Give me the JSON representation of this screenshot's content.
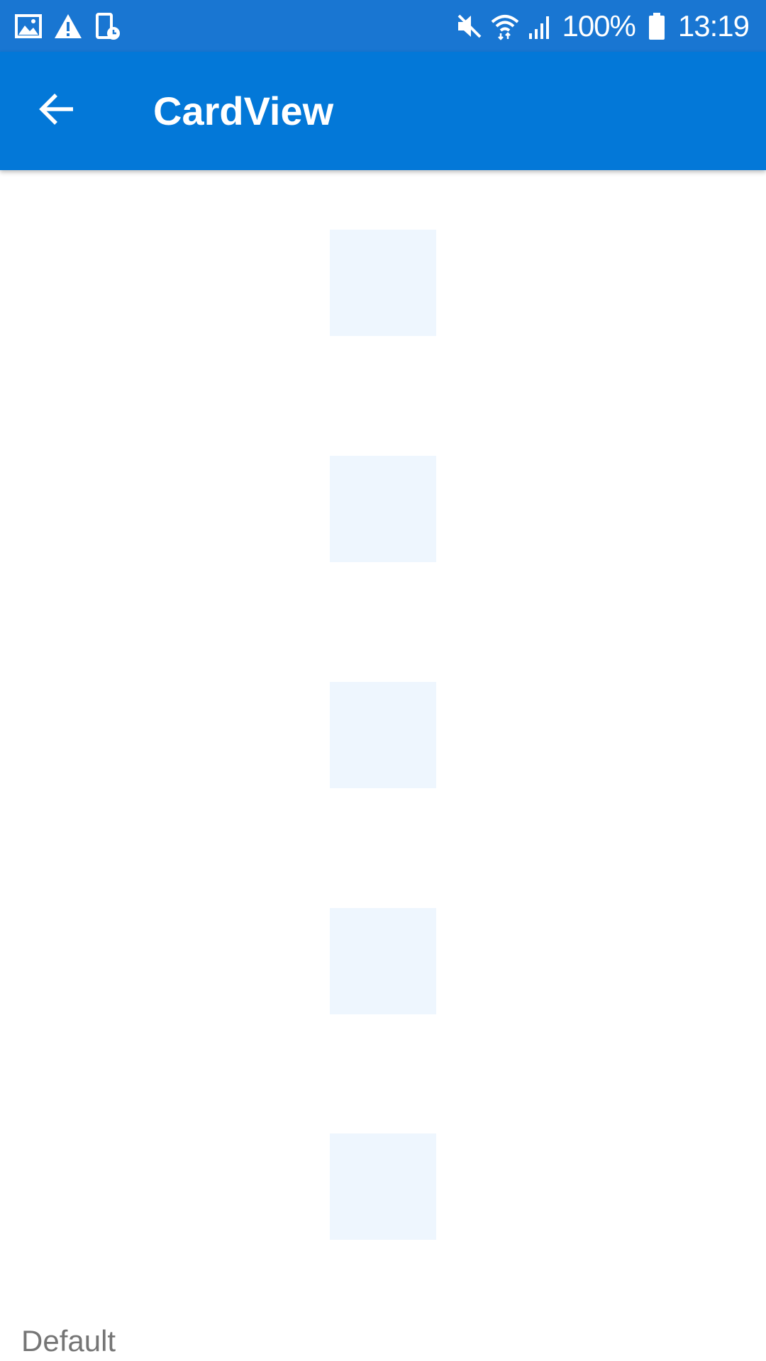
{
  "status_bar": {
    "battery_percent": "100%",
    "time": "13:19",
    "icons_left": [
      "image-icon",
      "warning-icon",
      "screen-timer-icon"
    ],
    "icons_right": [
      "mute-icon",
      "wifi-icon",
      "signal-icon",
      "battery-icon"
    ]
  },
  "app_bar": {
    "title": "CardView",
    "back_icon": "arrow-back-icon"
  },
  "content": {
    "cards": [
      {
        "id": "card-1"
      },
      {
        "id": "card-2"
      },
      {
        "id": "card-3"
      },
      {
        "id": "card-4"
      },
      {
        "id": "card-5"
      }
    ],
    "section_label": "Default"
  },
  "colors": {
    "status_bar": "#1976d2",
    "app_bar": "#0378d8",
    "card": "#eef6fe",
    "label_text": "#757575"
  }
}
